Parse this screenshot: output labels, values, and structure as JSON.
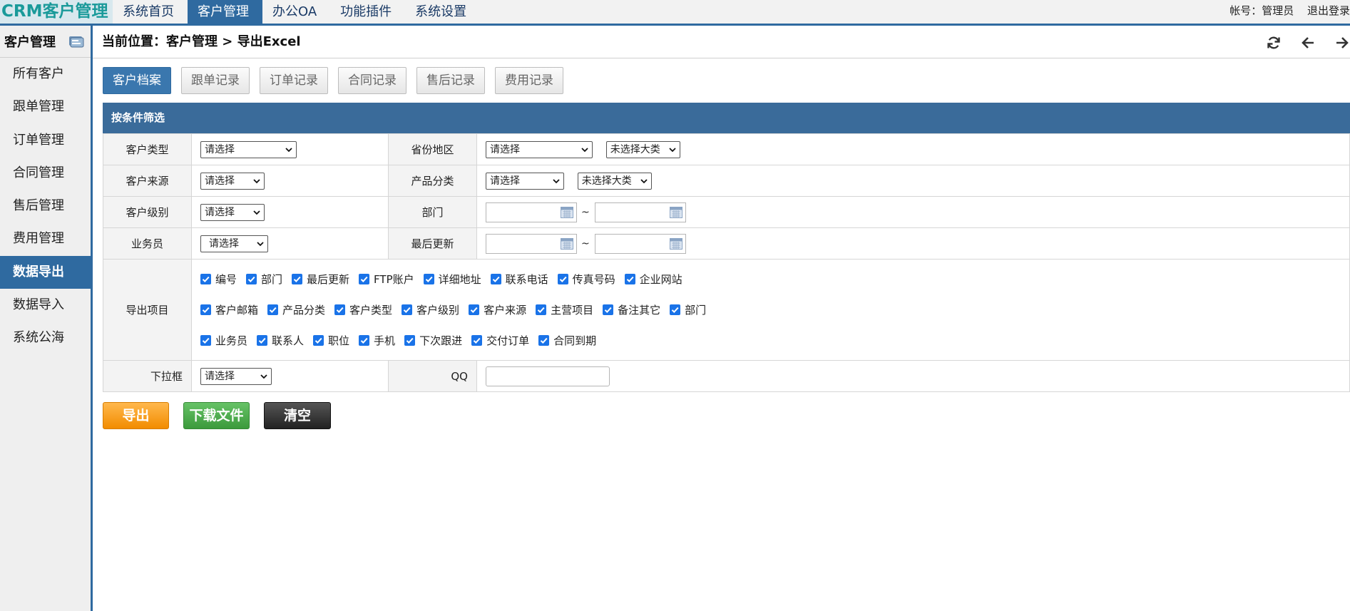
{
  "app": {
    "logo": "CRM客户管理"
  },
  "nav": {
    "items": [
      {
        "label": "系统首页"
      },
      {
        "label": "客户管理"
      },
      {
        "label": "办公OA"
      },
      {
        "label": "功能插件"
      },
      {
        "label": "系统设置"
      }
    ],
    "active_index": 1
  },
  "user": {
    "account": "帐号：管理员",
    "logout": "退出登录"
  },
  "sidebar": {
    "title": "客户管理",
    "items": [
      {
        "label": "所有客户"
      },
      {
        "label": "跟单管理"
      },
      {
        "label": "订单管理"
      },
      {
        "label": "合同管理"
      },
      {
        "label": "售后管理"
      },
      {
        "label": "费用管理"
      },
      {
        "label": "数据导出"
      },
      {
        "label": "数据导入"
      },
      {
        "label": "系统公海"
      }
    ],
    "active_index": 6
  },
  "breadcrumb": {
    "text": "当前位置：客户管理 > 导出Excel"
  },
  "tabs": [
    {
      "label": "客户档案"
    },
    {
      "label": "跟单记录"
    },
    {
      "label": "订单记录"
    },
    {
      "label": "合同记录"
    },
    {
      "label": "售后记录"
    },
    {
      "label": "费用记录"
    }
  ],
  "active_tab": 0,
  "filter": {
    "title": "按条件筛选",
    "customer_type": {
      "label": "客户类型",
      "value": "请选择"
    },
    "region": {
      "label": "省份地区",
      "value": "请选择",
      "value2": "未选择大类"
    },
    "customer_source": {
      "label": "客户来源",
      "value": "请选择"
    },
    "product_category": {
      "label": "产品分类",
      "value": "请选择",
      "value2": "未选择大类"
    },
    "customer_level": {
      "label": "客户级别",
      "value": "请选择"
    },
    "department": {
      "label": "部门",
      "separator": "~"
    },
    "salesman": {
      "label": "业务员",
      "value": "请选择"
    },
    "last_update": {
      "label": "最后更新",
      "separator": "~"
    },
    "export_items": {
      "label": "导出项目",
      "rows": [
        [
          "编号",
          "部门",
          "最后更新",
          "FTP账户",
          "详细地址",
          "联系电话",
          "传真号码",
          "企业网站"
        ],
        [
          "客户邮箱",
          "产品分类",
          "客户类型",
          "客户级别",
          "客户来源",
          "主营项目",
          "备注其它",
          "部门"
        ],
        [
          "业务员",
          "联系人",
          "职位",
          "手机",
          "下次跟进",
          "交付订单",
          "合同到期"
        ]
      ]
    },
    "dropdown": {
      "label": "下拉框",
      "value": "请选择"
    },
    "qq": {
      "label": "QQ",
      "value": ""
    }
  },
  "actions": {
    "export": "导出",
    "download": "下载文件",
    "clear": "清空"
  },
  "colors": {
    "primary": "#2f6aa0",
    "logo_text": "#1a9a9a",
    "export_btn": "#f28c00",
    "download_btn": "#3c9a3c",
    "clear_btn": "#222222",
    "checkbox": "#1a73e8"
  }
}
